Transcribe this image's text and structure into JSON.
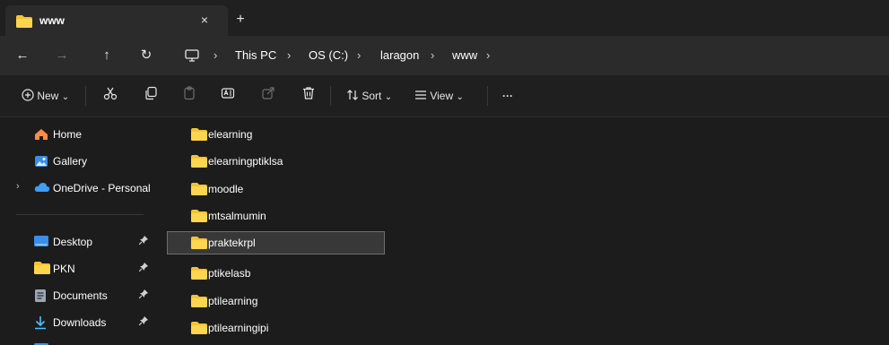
{
  "window": {
    "tab_title": "www",
    "close_glyph": "×",
    "new_tab_glyph": "+"
  },
  "nav": {
    "back_glyph": "←",
    "forward_glyph": "→",
    "up_glyph": "↑",
    "refresh_glyph": "↻",
    "sep_glyph": "›",
    "breadcrumbs": [
      "This PC",
      "OS (C:)",
      "laragon",
      "www"
    ]
  },
  "toolbar": {
    "new_label": "New",
    "sort_label": "Sort",
    "view_label": "View",
    "more_glyph": "···",
    "chevron_glyph": "⌄"
  },
  "sidebar": {
    "items": [
      {
        "label": "Home",
        "icon": "home-icon"
      },
      {
        "label": "Gallery",
        "icon": "gallery-icon"
      },
      {
        "label": "OneDrive - Personal",
        "icon": "cloud-icon"
      },
      {
        "label": "Desktop",
        "icon": "desktop-icon",
        "pinned": true
      },
      {
        "label": "PKN",
        "icon": "folder-icon",
        "pinned": true
      },
      {
        "label": "Documents",
        "icon": "document-icon",
        "pinned": true
      },
      {
        "label": "Downloads",
        "icon": "download-icon",
        "pinned": true
      }
    ],
    "pin_glyph": "📌",
    "expand_glyph": "›"
  },
  "files": [
    {
      "name": "elearning"
    },
    {
      "name": "elearningptiklsa"
    },
    {
      "name": "moodle"
    },
    {
      "name": "mtsalmumin"
    },
    {
      "name": "praktekrpl",
      "selected": true
    },
    {
      "name": "ptikelasb"
    },
    {
      "name": "ptilearning"
    },
    {
      "name": "ptilearningipi"
    }
  ],
  "colors": {
    "folder": "#f4c430",
    "accent": "#4cc2ff",
    "selection": "#383838"
  }
}
